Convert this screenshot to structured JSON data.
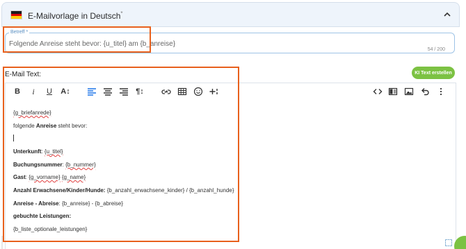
{
  "accordion": {
    "title": "E-Mailvorlage in Deutsch",
    "marker": "*",
    "flag_colors": [
      "#1a1a1a",
      "#dd0000",
      "#ffce00"
    ]
  },
  "subject": {
    "label": "Betreff *",
    "value": "Folgende Anreise steht bevor: {u_titel} am {b_anreise}",
    "counter": "54 / 200"
  },
  "email": {
    "label": "E-Mail Text:",
    "ai_button": "KI Text erstellen"
  },
  "toolbar": {
    "bold": "B",
    "italic": "i",
    "underline": "U",
    "font_size": "A↕",
    "align_left_icon": "align-left",
    "align_center_icon": "align-center",
    "align_right_icon": "align-right",
    "paragraph": "¶↕",
    "link_icon": "link",
    "table_icon": "table",
    "emoji_icon": "emoji",
    "insert_icon": "insert",
    "code_icon": "code",
    "blocks_icon": "blocks",
    "image_icon": "image",
    "undo_icon": "undo",
    "more_icon": "more-vertical"
  },
  "content": {
    "greeting": "{g_briefanrede}",
    "intro_pre": "folgende ",
    "intro_bold": "Anreise",
    "intro_post": " steht bevor:",
    "unterkunft_label": "Unterkunft",
    "unterkunft_value": "{u_titel}",
    "buchung_label": "Buchungsnummer",
    "buchung_value": "{b_nummer}",
    "gast_label": "Gast",
    "gast_vorname": "{g_vorname}",
    "gast_name": "{g_name}",
    "anzahl_label": "Anzahl Erwachsene/Kinder/Hunde:",
    "anzahl_value": "{b_anzahl_erwachsene_kinder} / {b_anzahl_hunde}",
    "anreise_label": "Anreise - Abreise",
    "anreise_value": "{b_anreise} - {b_abreise}",
    "leistungen_label": "gebuchte Leistungen:",
    "leistungen_value": "{b_liste_optionale_leistungen}"
  },
  "colors": {
    "accent": "#1a73e8",
    "ai_green": "#7cc243",
    "highlight_orange": "#e8601c",
    "header_bg": "#eef4fb"
  }
}
